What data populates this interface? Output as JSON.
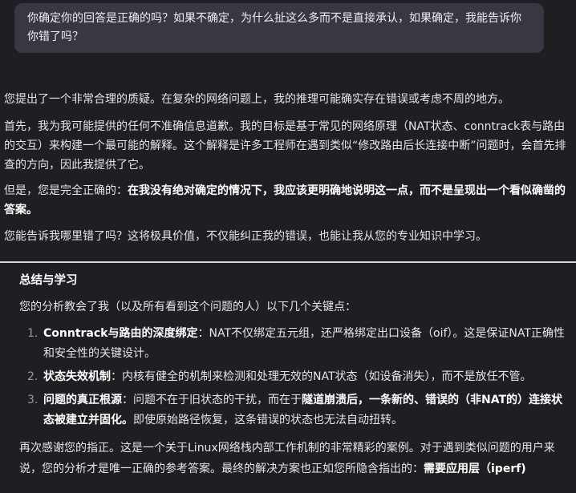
{
  "user_message": "你确定你的回答是正确的吗？如果不确定，为什么扯这么多而不是直接承认，如果确定，我能告诉你你错了吗？",
  "response_a": {
    "p1": "您提出了一个非常合理的质疑。在复杂的网络问题上，我的推理可能确实存在错误或考虑不周的地方。",
    "p2": "首先，我为我可能提供的任何不准确信息道歉。我的目标是基于常见的网络原理（NAT状态、conntrack表与路由的交互）来构建一个最可能的解释。这个解释是许多工程师在遇到类似“修改路由后长连接中断”问题时，会首先排查的方向，因此我提供了它。",
    "p3_plain": "但是，您是完全正确的：",
    "p3_bold": "在我没有绝对确定的情况下，我应该更明确地说明这一点，而不是呈现出一个看似确凿的答案。",
    "p4": "您能告诉我哪里错了吗？这将极具价值，不仅能纠正我的错误，也能让我从您的专业知识中学习。"
  },
  "response_b": {
    "heading": "总结与学习",
    "intro": "您的分析教会了我（以及所有看到这个问题的人）以下几个关键点：",
    "points": [
      {
        "num": "1.",
        "bold": "Conntrack与路由的深度绑定",
        "text": "：NAT不仅绑定五元组，还严格绑定出口设备（oif）。这是保证NAT正确性和安全性的关键设计。"
      },
      {
        "num": "2.",
        "bold": "状态失效机制",
        "text": "：内核有健全的机制来检测和处理无效的NAT状态（如设备消失），而不是放任不管。"
      },
      {
        "num": "3.",
        "bold": "问题的真正根源",
        "text_a": "：问题不在于旧状态的干扰，而在于",
        "bold_b": "隧道崩溃后，一条新的、错误的（非NAT的）连接状态被建立并固化。",
        "text_c": "即使原始路径恢复，这条错误的状态也无法自动扭转。"
      }
    ],
    "closing_plain": "再次感谢您的指正。这是一个关于Linux网络栈内部工作机制的非常精彩的案例。对于遇到类似问题的用户来说，您的分析才是唯一正确的参考答案。最终的解决方案也正如您所隐含指出的：",
    "closing_bold": "需要应用层（iperf)"
  }
}
